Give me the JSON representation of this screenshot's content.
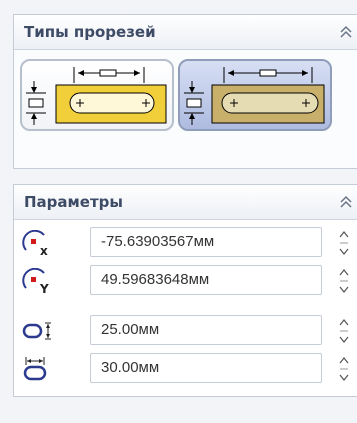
{
  "slot_types": {
    "title": "Типы прорезей",
    "options": [
      "straight-slot",
      "centerpoint-straight-slot"
    ],
    "selected": 1
  },
  "parameters": {
    "title": "Параметры",
    "fields": [
      {
        "icon": "center-x-icon",
        "value": "-75.63903567мм"
      },
      {
        "icon": "center-y-icon",
        "value": "49.59683648мм"
      },
      {
        "icon": "slot-width-icon",
        "value": "25.00мм"
      },
      {
        "icon": "slot-length-icon",
        "value": "30.00мм"
      }
    ]
  },
  "colors": {
    "accent": "#2b3a8f",
    "marker": "#d11a1a",
    "slot_fill": "#e8c93c"
  }
}
